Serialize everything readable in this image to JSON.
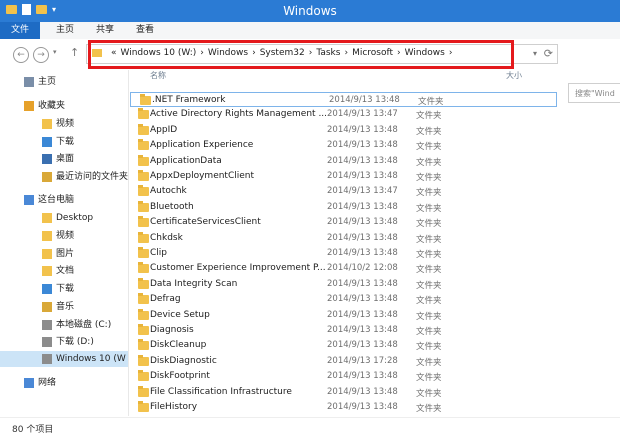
{
  "window": {
    "title": "Windows"
  },
  "ribbon": {
    "tabs": [
      {
        "label": "文件"
      },
      {
        "label": "主页"
      },
      {
        "label": "共享"
      },
      {
        "label": "查看"
      }
    ]
  },
  "address": {
    "crumbs": [
      "«",
      "Windows 10 (W:)",
      "›",
      "Windows",
      "›",
      "System32",
      "›",
      "Tasks",
      "›",
      "Microsoft",
      "›",
      "Windows",
      "›"
    ]
  },
  "search": {
    "placeholder": "搜索\"Wind"
  },
  "columns": {
    "name": "名称",
    "size": "大小"
  },
  "sidebar": {
    "items": [
      {
        "label": "主页",
        "icon": "home-icon"
      },
      {
        "label": "收藏夹",
        "icon": "star-icon"
      },
      {
        "label": "视频",
        "icon": "folder-icon"
      },
      {
        "label": "下载",
        "icon": "download-folder-icon"
      },
      {
        "label": "桌面",
        "icon": "desktop-icon"
      },
      {
        "label": "最近访问的文件夹",
        "icon": "recent-folder-icon"
      },
      {
        "label": "这台电脑",
        "icon": "computer-icon"
      },
      {
        "label": "Desktop",
        "icon": "folder-icon"
      },
      {
        "label": "视频",
        "icon": "folder-icon"
      },
      {
        "label": "图片",
        "icon": "folder-icon"
      },
      {
        "label": "文档",
        "icon": "folder-icon"
      },
      {
        "label": "下载",
        "icon": "download-folder-icon"
      },
      {
        "label": "音乐",
        "icon": "music-folder-icon"
      },
      {
        "label": "本地磁盘 (C:)",
        "icon": "drive-icon"
      },
      {
        "label": "下载 (D:)",
        "icon": "drive-icon"
      },
      {
        "label": "Windows 10 (W",
        "icon": "drive-icon"
      },
      {
        "label": "网络",
        "icon": "network-icon"
      }
    ]
  },
  "files": [
    {
      "name": ".NET Framework",
      "date": "2014/9/13 13:48",
      "type": "文件夹"
    },
    {
      "name": "Active Directory Rights Management ...",
      "date": "2014/9/13 13:47",
      "type": "文件夹"
    },
    {
      "name": "AppID",
      "date": "2014/9/13 13:48",
      "type": "文件夹"
    },
    {
      "name": "Application Experience",
      "date": "2014/9/13 13:48",
      "type": "文件夹"
    },
    {
      "name": "ApplicationData",
      "date": "2014/9/13 13:48",
      "type": "文件夹"
    },
    {
      "name": "AppxDeploymentClient",
      "date": "2014/9/13 13:48",
      "type": "文件夹"
    },
    {
      "name": "Autochk",
      "date": "2014/9/13 13:47",
      "type": "文件夹"
    },
    {
      "name": "Bluetooth",
      "date": "2014/9/13 13:48",
      "type": "文件夹"
    },
    {
      "name": "CertificateServicesClient",
      "date": "2014/9/13 13:48",
      "type": "文件夹"
    },
    {
      "name": "Chkdsk",
      "date": "2014/9/13 13:48",
      "type": "文件夹"
    },
    {
      "name": "Clip",
      "date": "2014/9/13 13:48",
      "type": "文件夹"
    },
    {
      "name": "Customer Experience Improvement P...",
      "date": "2014/10/2 12:08",
      "type": "文件夹"
    },
    {
      "name": "Data Integrity Scan",
      "date": "2014/9/13 13:48",
      "type": "文件夹"
    },
    {
      "name": "Defrag",
      "date": "2014/9/13 13:48",
      "type": "文件夹"
    },
    {
      "name": "Device Setup",
      "date": "2014/9/13 13:48",
      "type": "文件夹"
    },
    {
      "name": "Diagnosis",
      "date": "2014/9/13 13:48",
      "type": "文件夹"
    },
    {
      "name": "DiskCleanup",
      "date": "2014/9/13 13:48",
      "type": "文件夹"
    },
    {
      "name": "DiskDiagnostic",
      "date": "2014/9/13 17:28",
      "type": "文件夹"
    },
    {
      "name": "DiskFootprint",
      "date": "2014/9/13 13:48",
      "type": "文件夹"
    },
    {
      "name": "File Classification Infrastructure",
      "date": "2014/9/13 13:48",
      "type": "文件夹"
    },
    {
      "name": "FileHistory",
      "date": "2014/9/13 13:48",
      "type": "文件夹"
    }
  ],
  "status": {
    "count": "80 个项目"
  }
}
